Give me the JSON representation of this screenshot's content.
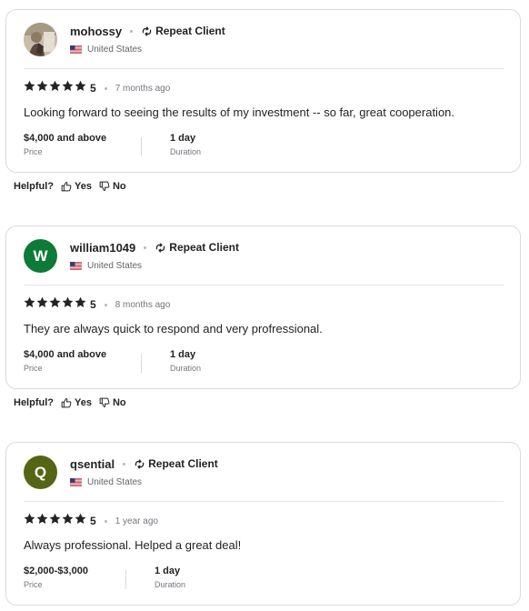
{
  "colors": {
    "avatar_w": "#0e7a37",
    "avatar_q": "#556516",
    "star": "#222325",
    "border": "#dadbdd",
    "muted_text": "#74767e"
  },
  "icons": {
    "repeat": "repeat-icon",
    "flag": "us-flag-icon",
    "star": "star-icon",
    "thumbs_up": "thumbs-up-icon",
    "thumbs_down": "thumbs-down-icon"
  },
  "reviews": [
    {
      "username": "mohossy",
      "avatar_letter": "",
      "repeat_label": "Repeat Client",
      "country": "United States",
      "rating": "5",
      "stars": 5,
      "time_ago": "7 months ago",
      "text": "Looking forward to seeing the results of my investment -- so far, great cooperation.",
      "price_value": "$4,000 and above",
      "price_label": "Price",
      "duration_value": "1 day",
      "duration_label": "Duration"
    },
    {
      "username": "william1049",
      "avatar_letter": "W",
      "repeat_label": "Repeat Client",
      "country": "United States",
      "rating": "5",
      "stars": 5,
      "time_ago": "8 months ago",
      "text": "They are always quick to respond and very profressional.",
      "price_value": "$4,000 and above",
      "price_label": "Price",
      "duration_value": "1 day",
      "duration_label": "Duration"
    },
    {
      "username": "qsential",
      "avatar_letter": "Q",
      "repeat_label": "Repeat Client",
      "country": "United States",
      "rating": "5",
      "stars": 5,
      "time_ago": "1 year ago",
      "text": "Always professional. Helped a great deal!",
      "price_value": "$2,000-$3,000",
      "price_label": "Price",
      "duration_value": "1 day",
      "duration_label": "Duration"
    }
  ],
  "helpful": {
    "label": "Helpful?",
    "yes": "Yes",
    "no": "No"
  }
}
